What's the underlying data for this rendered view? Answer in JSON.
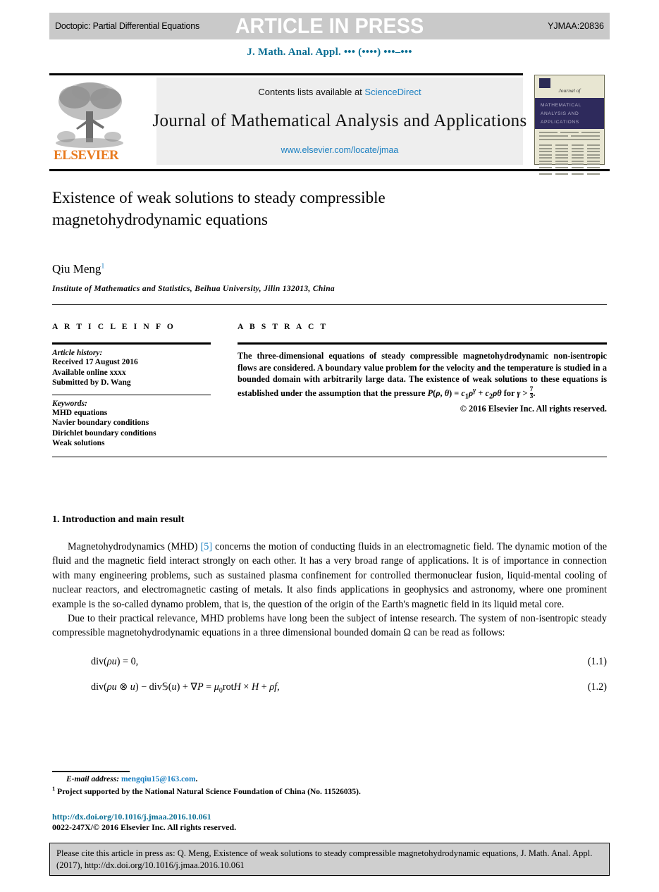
{
  "header": {
    "doctopic": "Doctopic: Partial Differential Equations",
    "status": "ARTICLE IN PRESS",
    "code": "YJMAA:20836",
    "journal_ref": "J. Math. Anal. Appl. ••• (••••) •••–•••",
    "link_color": "#0b6f94"
  },
  "masthead": {
    "contents_prefix": "Contents lists available at ",
    "sciencedirect": "ScienceDirect",
    "journal_name": "Journal of Mathematical Analysis and Applications",
    "url": "www.elsevier.com/locate/jmaa",
    "publisher_logo": "ELSEVIER",
    "logo_color": "#e87a1e",
    "link_color": "#1a7fc1",
    "cover": {
      "journal_of": "Journal of",
      "band_line1": "MATHEMATICAL",
      "band_line2": "ANALYSIS AND",
      "band_line3": "APPLICATIONS",
      "band_color": "#2e2a5c"
    }
  },
  "article": {
    "title": "Existence of weak solutions to steady compressible magnetohydrodynamic equations",
    "author": "Qiu Meng",
    "author_footnote": "1",
    "affiliation": "Institute of Mathematics and Statistics, Beihua University, Jilin 132013, China"
  },
  "info": {
    "heading": "A R T I C L E   I N F O",
    "history_label": "Article history:",
    "history": [
      "Received 17 August 2016",
      "Available online xxxx",
      "Submitted by D. Wang"
    ],
    "keywords_label": "Keywords:",
    "keywords": [
      "MHD equations",
      "Navier boundary conditions",
      "Dirichlet boundary conditions",
      "Weak solutions"
    ]
  },
  "abstract": {
    "heading": "A B S T R A C T",
    "body": "The three-dimensional equations of steady compressible magnetohydrodynamic non-isentropic flows are considered. A boundary value problem for the velocity and the temperature is studied in a bounded domain with arbitrarily large data. The existence of weak solutions to these equations is established under the assumption that the pressure P(ρ, θ) = c₁ρ^γ + c₂ρθ for γ > 7/3.",
    "body_plain": "The three-dimensional equations of steady compressible magnetohydrodynamic non-isentropic flows are considered. A boundary value problem for the velocity and the temperature is studied in a bounded domain with arbitrarily large data. The existence of weak solutions to these equations is established under the assumption that the pressure",
    "formula_tail": "for",
    "copyright": "© 2016 Elsevier Inc. All rights reserved."
  },
  "section": {
    "heading": "1. Introduction and main result",
    "paragraph1_a": "Magnetohydrodynamics (MHD) ",
    "paragraph1_ref": "[5]",
    "paragraph1_b": " concerns the motion of conducting fluids in an electromagnetic field. The dynamic motion of the fluid and the magnetic field interact strongly on each other. It has a very broad range of applications. It is of importance in connection with many engineering problems, such as sustained plasma confinement for controlled thermonuclear fusion, liquid-mental cooling of nuclear reactors, and electromagnetic casting of metals. It also finds applications in geophysics and astronomy, where one prominent example is the so-called dynamo problem, that is, the question of the origin of the Earth's magnetic field in its liquid metal core.",
    "paragraph2": "Due to their practical relevance, MHD problems have long been the subject of intense research. The system of non-isentropic steady compressible magnetohydrodynamic equations in a three dimensional bounded domain Ω can be read as follows:"
  },
  "equations": [
    {
      "number": "(1.1)"
    },
    {
      "number": "(1.2)"
    }
  ],
  "footnotes": {
    "email_label": "E-mail address:",
    "email": "mengqiu15@163.com",
    "email_suffix": ".",
    "note_marker": "1",
    "note_text": "Project supported by the National Natural Science Foundation of China (No. 11526035)."
  },
  "imprint": {
    "doi": "http://dx.doi.org/10.1016/j.jmaa.2016.10.061",
    "issn_line": "0022-247X/© 2016 Elsevier Inc. All rights reserved."
  },
  "cite_box": {
    "text": "Please cite this article in press as: Q. Meng, Existence of weak solutions to steady compressible magnetohydrodynamic equations, J. Math. Anal. Appl. (2017), http://dx.doi.org/10.1016/j.jmaa.2016.10.061"
  }
}
